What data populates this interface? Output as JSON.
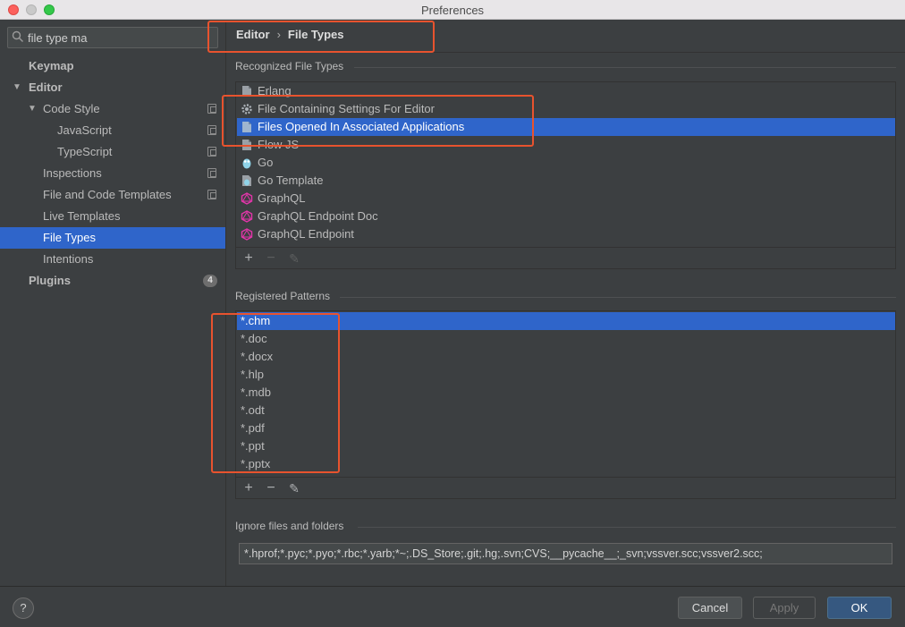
{
  "window": {
    "title": "Preferences"
  },
  "search": {
    "value": "file type ma"
  },
  "sidebar": {
    "items": [
      {
        "label": "Keymap"
      },
      {
        "label": "Editor"
      },
      {
        "label": "Code Style"
      },
      {
        "label": "JavaScript"
      },
      {
        "label": "TypeScript"
      },
      {
        "label": "Inspections"
      },
      {
        "label": "File and Code Templates"
      },
      {
        "label": "Live Templates"
      },
      {
        "label": "File Types"
      },
      {
        "label": "Intentions"
      },
      {
        "label": "Plugins",
        "badge": "4"
      }
    ]
  },
  "breadcrumb": {
    "parent": "Editor",
    "separator": "›",
    "current": "File Types"
  },
  "recognized": {
    "label": "Recognized File Types",
    "items": [
      {
        "label": "Erlang",
        "icon": "erlang-file-icon"
      },
      {
        "label": "File Containing Settings For Editor",
        "icon": "gear-icon"
      },
      {
        "label": "Files Opened In Associated Applications",
        "icon": "file-icon"
      },
      {
        "label": "Flow JS",
        "icon": "file-icon"
      },
      {
        "label": "Go",
        "icon": "go-gopher-icon"
      },
      {
        "label": "Go Template",
        "icon": "go-template-icon"
      },
      {
        "label": "GraphQL",
        "icon": "graphql-icon"
      },
      {
        "label": "GraphQL Endpoint Doc",
        "icon": "graphql-icon"
      },
      {
        "label": "GraphQL Endpoint",
        "icon": "graphql-icon"
      }
    ],
    "selected": "Files Opened In Associated Applications"
  },
  "patterns": {
    "label": "Registered Patterns",
    "items": [
      "*.chm",
      "*.doc",
      "*.docx",
      "*.hlp",
      "*.mdb",
      "*.odt",
      "*.pdf",
      "*.ppt",
      "*.pptx"
    ],
    "selected": "*.chm"
  },
  "toolbar": {
    "add": "+",
    "remove": "−",
    "edit": "✎"
  },
  "ignore": {
    "label": "Ignore files and folders",
    "value": "*.hprof;*.pyc;*.pyo;*.rbc;*.yarb;*~;.DS_Store;.git;.hg;.svn;CVS;__pycache__;_svn;vssver.scc;vssver2.scc;"
  },
  "buttons": {
    "help": "?",
    "cancel": "Cancel",
    "apply": "Apply",
    "ok": "OK"
  },
  "colors": {
    "selection": "#2f65ca",
    "annotation": "#e8532e",
    "background": "#3c3f41"
  }
}
